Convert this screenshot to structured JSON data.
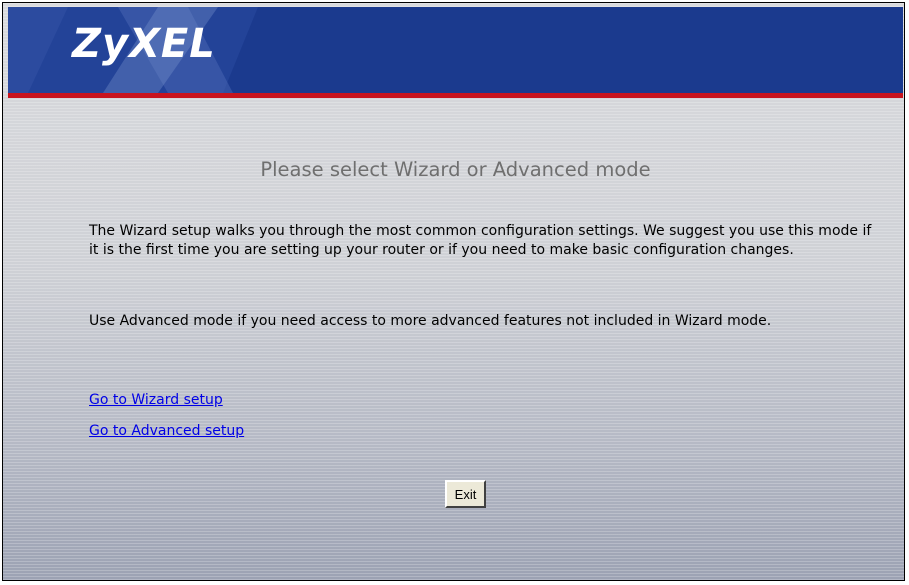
{
  "header": {
    "logo_text": "ZyXEL",
    "background_color": "#1b3a8e",
    "rule_color": "#c8141e"
  },
  "main": {
    "heading": "Please select Wizard or Advanced mode",
    "wizard_description": "The Wizard setup walks you through the most common configuration settings. We suggest you use this mode if it is the first time you are setting up your router or if you need to make basic configuration changes.",
    "advanced_description": "Use Advanced mode if you need access to more advanced features not included in Wizard mode.",
    "links": {
      "wizard_label": "Go to Wizard setup",
      "advanced_label": "Go to Advanced setup"
    },
    "exit_label": "Exit"
  }
}
